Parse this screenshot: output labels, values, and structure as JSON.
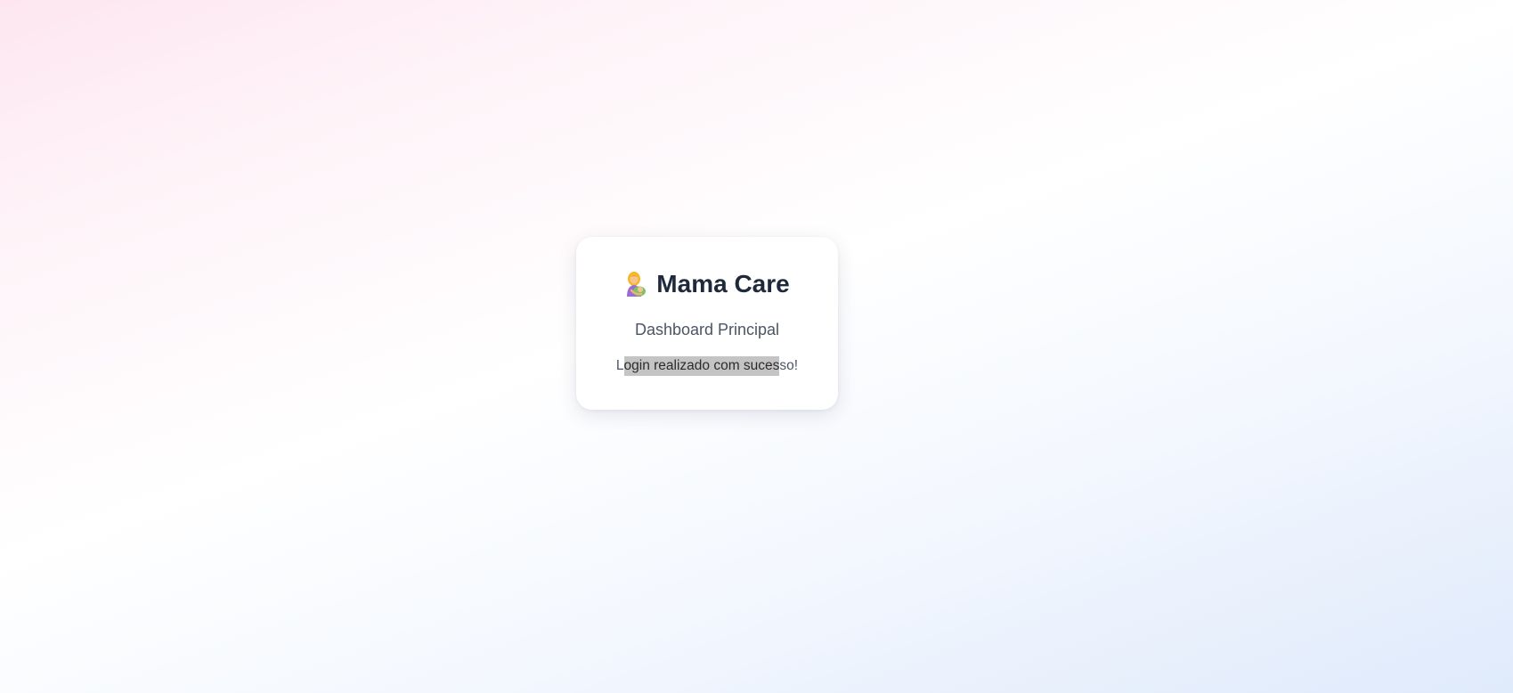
{
  "app": {
    "logo_icon": "mother-with-baby-emoji-icon",
    "title": "Mama Care",
    "subtitle": "Dashboard Principal",
    "message_before": "L",
    "message_selected": "ogin realizado com suces",
    "message_after": "so!"
  },
  "colors": {
    "title": "#1e293b",
    "text": "#4b5563",
    "selection": "#c4c4c4",
    "card": "#ffffff"
  }
}
